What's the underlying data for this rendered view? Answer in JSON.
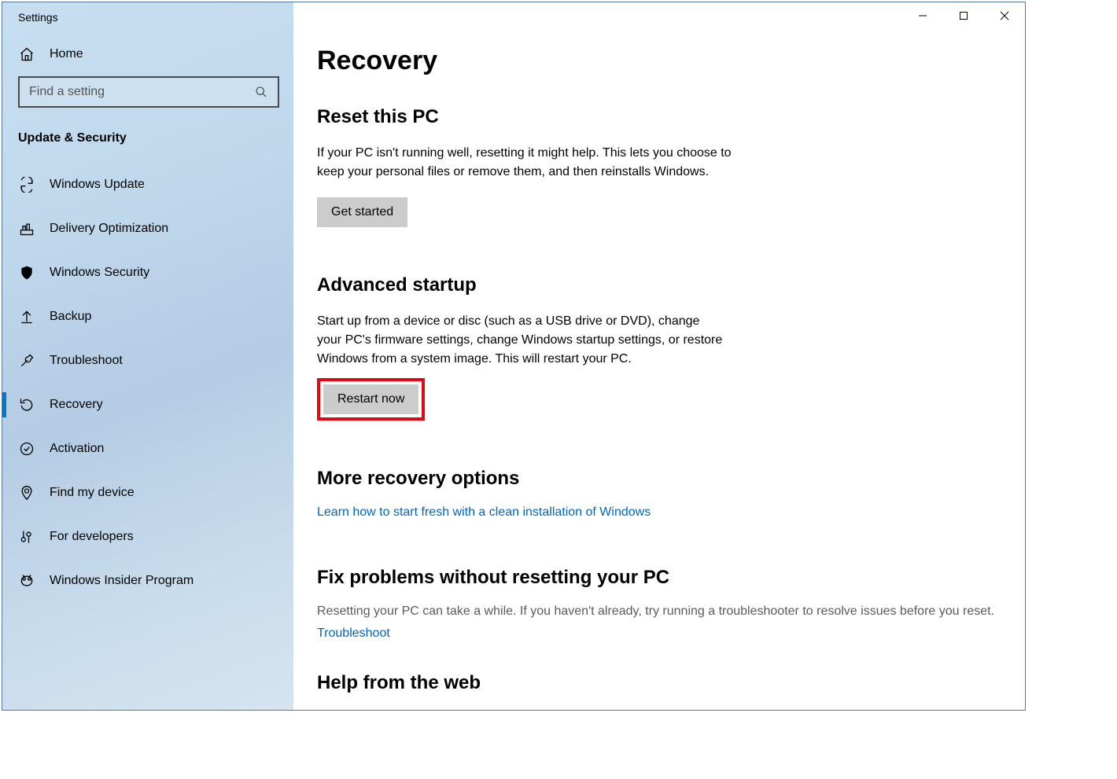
{
  "window": {
    "title": "Settings"
  },
  "sidebar": {
    "home_label": "Home",
    "search_placeholder": "Find a setting",
    "category_title": "Update & Security",
    "items": [
      {
        "label": "Windows Update"
      },
      {
        "label": "Delivery Optimization"
      },
      {
        "label": "Windows Security"
      },
      {
        "label": "Backup"
      },
      {
        "label": "Troubleshoot"
      },
      {
        "label": "Recovery"
      },
      {
        "label": "Activation"
      },
      {
        "label": "Find my device"
      },
      {
        "label": "For developers"
      },
      {
        "label": "Windows Insider Program"
      }
    ]
  },
  "main": {
    "page_title": "Recovery",
    "reset": {
      "title": "Reset this PC",
      "desc": "If your PC isn't running well, resetting it might help. This lets you choose to keep your personal files or remove them, and then reinstalls Windows.",
      "button": "Get started"
    },
    "advanced": {
      "title": "Advanced startup",
      "desc": "Start up from a device or disc (such as a USB drive or DVD), change your PC's firmware settings, change Windows startup settings, or restore Windows from a system image. This will restart your PC.",
      "button": "Restart now"
    },
    "more": {
      "title": "More recovery options",
      "link": "Learn how to start fresh with a clean installation of Windows"
    },
    "fix": {
      "title": "Fix problems without resetting your PC",
      "desc": "Resetting your PC can take a while. If you haven't already, try running a troubleshooter to resolve issues before you reset.",
      "link": "Troubleshoot"
    },
    "helpweb": {
      "title": "Help from the web"
    }
  }
}
